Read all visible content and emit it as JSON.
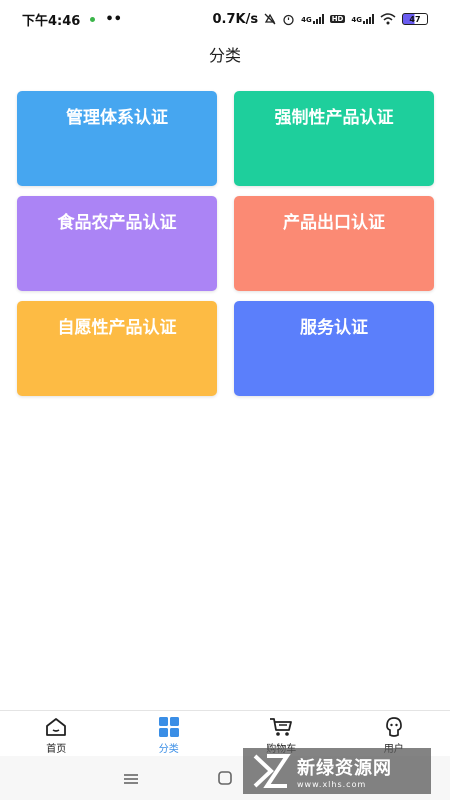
{
  "status_bar": {
    "time": "下午4:46",
    "dots": "••",
    "network_speed": "0.7K/s",
    "signal_label_1": "4G",
    "hd_label": "HD",
    "signal_label_2": "4G",
    "battery_level": "47"
  },
  "header": {
    "title": "分类"
  },
  "categories": [
    {
      "label": "管理体系认证",
      "color": "#46a6f0"
    },
    {
      "label": "强制性产品认证",
      "color": "#1ecf9c"
    },
    {
      "label": "食品农产品认证",
      "color": "#ab84f5"
    },
    {
      "label": "产品出口认证",
      "color": "#fb8a74"
    },
    {
      "label": "自愿性产品认证",
      "color": "#fdbb44"
    },
    {
      "label": "服务认证",
      "color": "#5b7ffb"
    }
  ],
  "tabs": [
    {
      "label": "首页",
      "icon": "home-icon",
      "active": false
    },
    {
      "label": "分类",
      "icon": "category-grid-icon",
      "active": true
    },
    {
      "label": "购物车",
      "icon": "shopping-cart-icon",
      "active": false
    },
    {
      "label": "用户",
      "icon": "user-icon",
      "active": false
    }
  ],
  "accent_color": "#3a8ee6",
  "watermark": {
    "text": "新绿资源网",
    "subtext": "www.xlhs.com"
  }
}
